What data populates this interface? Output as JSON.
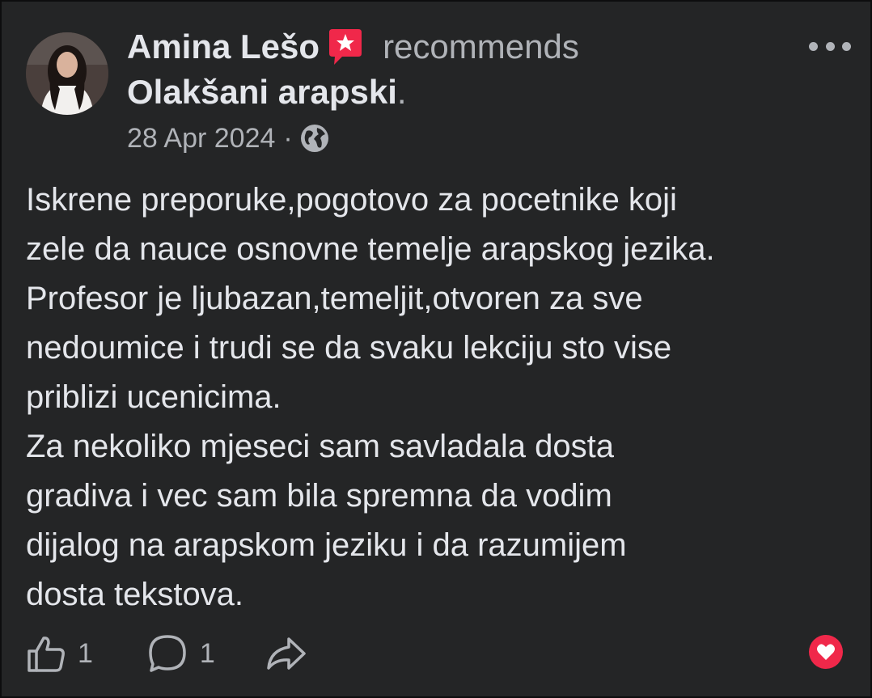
{
  "post": {
    "author": "Amina Lešo",
    "action": "recommends",
    "page_name": "Olakšani arapski",
    "period": ".",
    "date": "28 Apr 2024",
    "separator": "·",
    "privacy_icon": "globe-icon",
    "body_lines": [
      "Iskrene preporuke,pogotovo za pocetnike koji",
      "zele da nauce osnovne temelje arapskog jezika.",
      "Profesor je ljubazan,temeljit,otvoren za sve",
      "nedoumice i trudi se da svaku lekciju sto vise",
      "priblizi ucenicima.",
      "Za nekoliko mjeseci sam savladala dosta",
      "gradiva i vec sam bila spremna da vodim",
      "dijalog na arapskom jeziku i da razumijem",
      "dosta tekstova."
    ]
  },
  "actions": {
    "like_count": "1",
    "comment_count": "1"
  },
  "colors": {
    "background": "#242526",
    "text_primary": "#e4e6eb",
    "text_secondary": "#b0b3b8",
    "recommend_badge": "#f0284a",
    "love_reaction": "#f0284a"
  }
}
